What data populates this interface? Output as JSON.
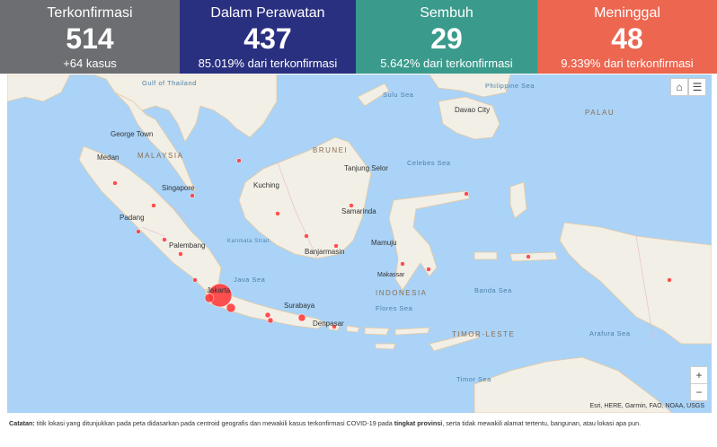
{
  "stats": [
    {
      "label": "Terkonfirmasi",
      "value": "514",
      "sub": "+64 kasus",
      "color": "#6d6e71"
    },
    {
      "label": "Dalam Perawatan",
      "value": "437",
      "sub": "85.019% dari terkonfirmasi",
      "color": "#2a3080"
    },
    {
      "label": "Sembuh",
      "value": "29",
      "sub": "5.642% dari terkonfirmasi",
      "color": "#3a9b8c"
    },
    {
      "label": "Meninggal",
      "value": "48",
      "sub": "9.339% dari terkonfirmasi",
      "color": "#ec6650"
    }
  ],
  "map": {
    "cities": [
      "Medan",
      "George Town",
      "Singapore",
      "Padang",
      "Palembang",
      "Jakarta",
      "Surabaya",
      "Denpasar",
      "Kuching",
      "Samarinda",
      "Banjarmasin",
      "Makassar",
      "Mamuju",
      "Davao City",
      "Tanjung Selor"
    ],
    "countries": [
      "MALAYSIA",
      "BRUNEI",
      "INDONESIA",
      "TIMOR-LESTE",
      "PALAU"
    ],
    "seas": [
      "Gulf of Thailand",
      "Sulu Sea",
      "Philippine Sea",
      "Celebes Sea",
      "Java Sea",
      "Flores Sea",
      "Banda Sea",
      "Arafura Sea",
      "Timor Sea",
      "Karimata Strait"
    ],
    "attribution": "Esri, HERE, Garmin, FAO, NOAA, USGS",
    "controls": {
      "zoom_in": "+",
      "zoom_out": "−",
      "home": "⌂",
      "list": "☰"
    },
    "marker_color": "#ff3333"
  },
  "note": {
    "prefix": "Catatan:",
    "text1": " titik lokasi yang ditunjukkan pada peta didasarkan pada centroid geografis dan mewakili kasus terkonfirmasi COVID-19 pada ",
    "bold": "tingkat provinsi",
    "text2": ", serta tidak mewakili alamat tertentu, bangunan, atau lokasi apa pun."
  }
}
